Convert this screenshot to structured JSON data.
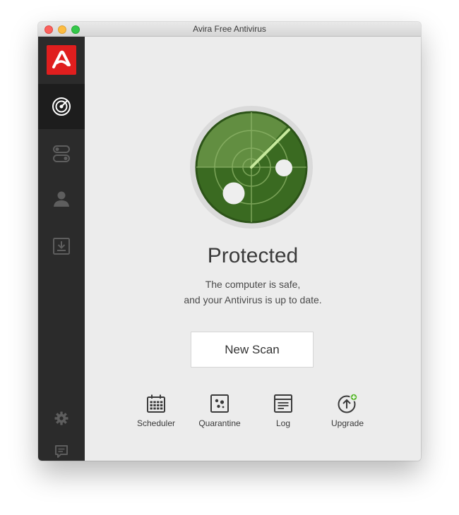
{
  "window": {
    "title": "Avira Free Antivirus"
  },
  "sidebar": {
    "items": [
      {
        "icon": "radar-scan-icon",
        "active": true
      },
      {
        "icon": "toggle-switches-icon",
        "active": false
      },
      {
        "icon": "user-icon",
        "active": false
      },
      {
        "icon": "download-icon",
        "active": false
      }
    ],
    "bottom_items": [
      {
        "icon": "gear-icon"
      },
      {
        "icon": "feedback-icon"
      }
    ]
  },
  "status": {
    "title": "Protected",
    "line1": "The computer is safe,",
    "line2": "and your Antivirus is up to date."
  },
  "actions": {
    "scan_label": "New Scan"
  },
  "tools": [
    {
      "label": "Scheduler",
      "icon": "calendar-icon"
    },
    {
      "label": "Quarantine",
      "icon": "quarantine-icon"
    },
    {
      "label": "Log",
      "icon": "log-icon"
    },
    {
      "label": "Upgrade",
      "icon": "upgrade-icon"
    }
  ],
  "colors": {
    "brand_red": "#e01e1e",
    "radar_green": "#3d6b22",
    "sidebar_bg": "#2b2b2b"
  }
}
